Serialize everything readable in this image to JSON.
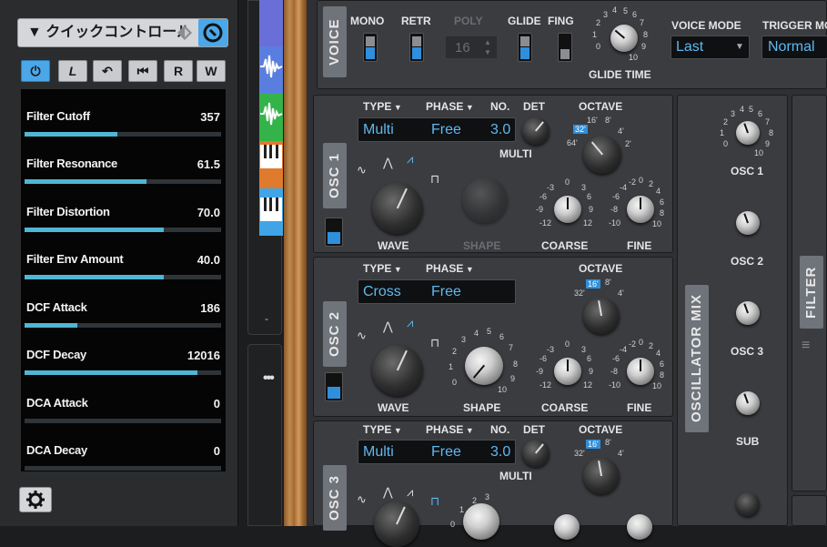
{
  "quick_controls": {
    "title": "クイックコントロール",
    "tools": [
      "⏻",
      "L",
      "↶",
      "⏮",
      "R",
      "W"
    ],
    "items": [
      {
        "name": "Filter Cutoff",
        "value": "357",
        "fill": 0.47
      },
      {
        "name": "Filter Resonance",
        "value": "61.5",
        "fill": 0.62
      },
      {
        "name": "Filter Distortion",
        "value": "70.0",
        "fill": 0.71
      },
      {
        "name": "Filter Env Amount",
        "value": "40.0",
        "fill": 0.71
      },
      {
        "name": "DCF Attack",
        "value": "186",
        "fill": 0.27
      },
      {
        "name": "DCF Decay",
        "value": "12016",
        "fill": 0.88
      },
      {
        "name": "DCA Attack",
        "value": "0",
        "fill": 0
      },
      {
        "name": "DCA Decay",
        "value": "0",
        "fill": 0
      }
    ]
  },
  "track_strip": {
    "dash": "-",
    "dots": "•••"
  },
  "voice": {
    "label": "VOICE",
    "mono": "MONO",
    "retr": "RETR",
    "poly": "POLY",
    "poly_value": "16",
    "glide": "GLIDE",
    "fing": "FING",
    "glide_time": "GLIDE TIME",
    "voice_mode_label": "VOICE MODE",
    "voice_mode_value": "Last",
    "trigger_mode_label": "TRIGGER MO",
    "trigger_mode_value": "Normal",
    "glide_ticks": [
      "0",
      "1",
      "2",
      "3",
      "4",
      "5",
      "6",
      "7",
      "8",
      "9",
      "10"
    ]
  },
  "osc1": {
    "label": "OSC 1",
    "type_label": "TYPE",
    "phase_label": "PHASE",
    "no_label": "NO.",
    "det_label": "DET",
    "octave_label": "OCTAVE",
    "type_value": "Multi",
    "phase_value": "Free",
    "no_value": "3.0",
    "multi_label": "MULTI",
    "wave_label": "WAVE",
    "shape_label": "SHAPE",
    "coarse_label": "COARSE",
    "fine_label": "FINE",
    "octaves": [
      "64'",
      "32'",
      "16'",
      "8'",
      "4'",
      "2'"
    ],
    "coarse_ticks": [
      "-12",
      "-9",
      "-6",
      "-3",
      "0",
      "3",
      "6",
      "9",
      "12"
    ],
    "fine_ticks": [
      "-10",
      "-8",
      "-6",
      "-4",
      "-2",
      "0",
      "2",
      "4",
      "6",
      "8",
      "10"
    ]
  },
  "osc2": {
    "label": "OSC 2",
    "type_label": "TYPE",
    "phase_label": "PHASE",
    "octave_label": "OCTAVE",
    "type_value": "Cross",
    "phase_value": "Free",
    "wave_label": "WAVE",
    "shape_label": "SHAPE",
    "coarse_label": "COARSE",
    "fine_label": "FINE",
    "octaves": [
      "32'",
      "16'",
      "8'",
      "4'"
    ],
    "shape_ticks": [
      "0",
      "1",
      "2",
      "3",
      "4",
      "5",
      "6",
      "7",
      "8",
      "9",
      "10"
    ],
    "coarse_ticks": [
      "-12",
      "-9",
      "-6",
      "-3",
      "0",
      "3",
      "6",
      "9",
      "12"
    ],
    "fine_ticks": [
      "-10",
      "-8",
      "-6",
      "-4",
      "-2",
      "0",
      "2",
      "4",
      "6",
      "8",
      "10"
    ]
  },
  "osc3": {
    "label": "OSC 3",
    "type_label": "TYPE",
    "phase_label": "PHASE",
    "no_label": "NO.",
    "det_label": "DET",
    "octave_label": "OCTAVE",
    "type_value": "Multi",
    "phase_value": "Free",
    "no_value": "3.0",
    "multi_label": "MULTI",
    "octaves": [
      "32'",
      "16'",
      "8'",
      "4'"
    ],
    "shape_ticks": [
      "0",
      "1",
      "2",
      "3"
    ]
  },
  "osc_mix": {
    "label": "OSCILLATOR MIX",
    "knobs": [
      "OSC 1",
      "OSC 2",
      "OSC 3",
      "SUB"
    ],
    "ticks": [
      "0",
      "1",
      "2",
      "3",
      "4",
      "5",
      "6",
      "7",
      "8",
      "9",
      "10"
    ]
  },
  "filter": {
    "label": "FILTER"
  },
  "colors": {
    "accent": "#4aa7e8",
    "lcd_text": "#5fb8ef",
    "bar": "#4fb6d4"
  }
}
